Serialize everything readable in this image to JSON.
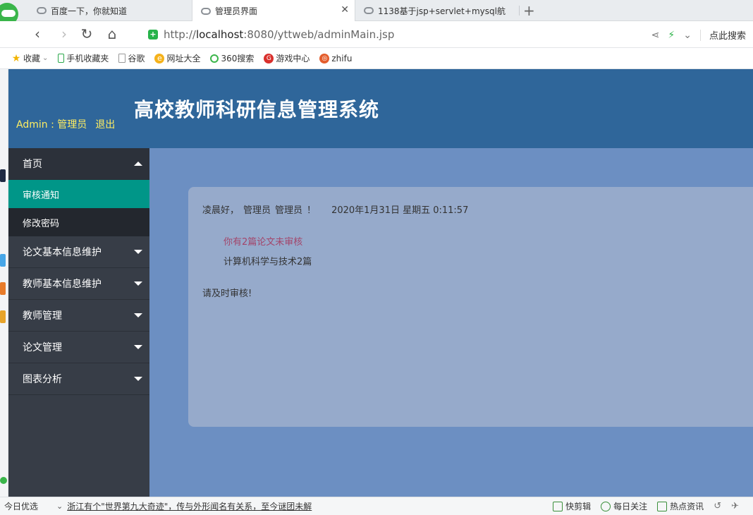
{
  "browser": {
    "tabs": [
      {
        "label": "百度一下，你就知道"
      },
      {
        "label": "管理员界面"
      },
      {
        "label": "1138基于jsp+servlet+mysql航"
      }
    ],
    "url_prefix": "http://",
    "url_host": "localhost",
    "url_rest": ":8080/yttweb/adminMain.jsp",
    "search_label": "点此搜索",
    "bookmarks": [
      {
        "label": "收藏",
        "icon": "star-icon"
      },
      {
        "label": "手机收藏夹",
        "icon": "phone-icon"
      },
      {
        "label": "谷歌",
        "icon": "page-icon"
      },
      {
        "label": "网址大全",
        "icon": "globe-icon"
      },
      {
        "label": "360搜索",
        "icon": "search-icon"
      },
      {
        "label": "游戏中心",
        "icon": "game-icon"
      },
      {
        "label": "zhifu",
        "icon": "site-icon"
      }
    ]
  },
  "header": {
    "title": "高校教师科研信息管理系统",
    "user": "Admin : 管理员",
    "logout": "退出"
  },
  "sidebar": {
    "home": "首页",
    "home_items": [
      "审核通知",
      "修改密码"
    ],
    "menus": [
      "论文基本信息维护",
      "教师基本信息维护",
      "教师管理",
      "论文管理",
      "图表分析"
    ]
  },
  "main": {
    "greeting": "凌晨好，",
    "role": "管理员",
    "name": "管理员",
    "exclaim": "！",
    "datetime": "2020年1月31日 星期五 0:11:57",
    "pending": "你有2篇论文未审核",
    "dept": "计算机科学与技术2篇",
    "remind": "请及时审核!"
  },
  "statusbar": {
    "left": "今日优选",
    "news": "浙江有个\"世界第九大奇迹\"，传与外形闻名有关系，至今谜团未解",
    "items": [
      "快剪辑",
      "每日关注",
      "热点资讯"
    ]
  },
  "colors": {
    "header_bg": "#2f669a",
    "sidebar_bg": "#373d47",
    "active_item": "#009688",
    "main_bg": "#6c8fc2",
    "card_bg": "#96aacb",
    "user_text": "#ffee62"
  }
}
